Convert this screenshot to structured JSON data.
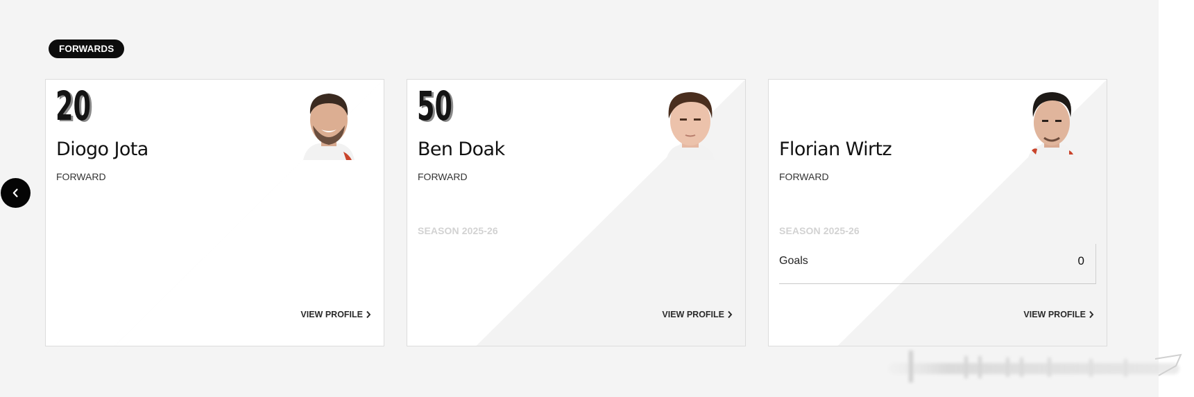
{
  "section": {
    "title": "FORWARDS"
  },
  "colors": {
    "accent": "#000000",
    "card_bg": "#f3f3f3",
    "diagonal": "#ffffff",
    "season_label": "#d2d2d2"
  },
  "nav": {
    "prev_icon": "chevron-left-icon"
  },
  "players": [
    {
      "number": "20",
      "name": "Diogo Jota",
      "position": "FORWARD",
      "season_label": "",
      "stats": [],
      "cta": "VIEW PROFILE"
    },
    {
      "number": "50",
      "name": "Ben Doak",
      "position": "FORWARD",
      "season_label": "SEASON 2025-26",
      "stats": [],
      "cta": "VIEW PROFILE"
    },
    {
      "number": "",
      "name": "Florian Wirtz",
      "position": "FORWARD",
      "season_label": "SEASON 2025-26",
      "stats": [
        {
          "label": "Goals",
          "value": "0"
        }
      ],
      "cta": "VIEW PROFILE"
    }
  ]
}
